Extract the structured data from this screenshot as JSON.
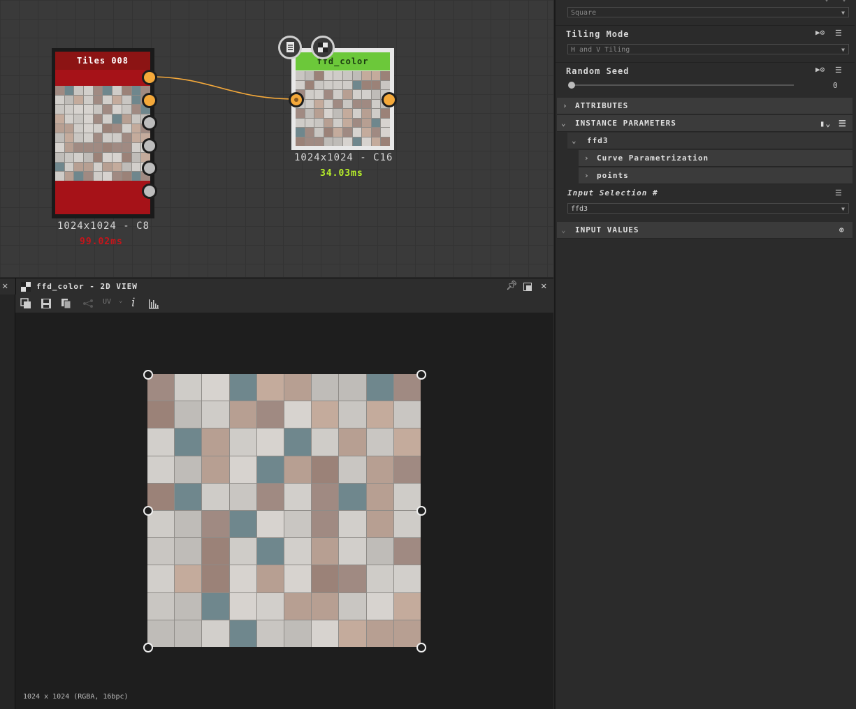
{
  "graph": {
    "tiles_node": {
      "title": "Tiles 008",
      "resolution": "1024x1024 - C8",
      "time": "99.02ms",
      "header_color": "#8c1414",
      "body_color": "#a61218"
    },
    "ffd_node": {
      "title": "ffd_color",
      "resolution": "1024x1024 - C16",
      "time": "34.03ms",
      "header_color": "#6cc83a",
      "time_color": "#b8f02a"
    },
    "control_icons": [
      "document-icon",
      "checker-icon"
    ],
    "link_color": "#f5a93a"
  },
  "view2d": {
    "title": "ffd_color - 2D VIEW",
    "toolbar": {
      "uv_label": "UV"
    },
    "status": "1024 x 1024 (RGBA, 16bpc)"
  },
  "panel": {
    "top_dropdown": "Square",
    "tiling_mode": {
      "label": "Tiling Mode",
      "value": "H and V Tiling"
    },
    "random_seed": {
      "label": "Random Seed",
      "value": "0"
    },
    "sections": {
      "attributes": "ATTRIBUTES",
      "instance_parameters": "INSTANCE PARAMETERS",
      "ffd3": "ffd3",
      "curve_param": "Curve Parametrization",
      "points": "points",
      "input_values": "INPUT VALUES"
    },
    "input_selection": {
      "label": "Input Selection #",
      "value": "ffd3"
    }
  }
}
